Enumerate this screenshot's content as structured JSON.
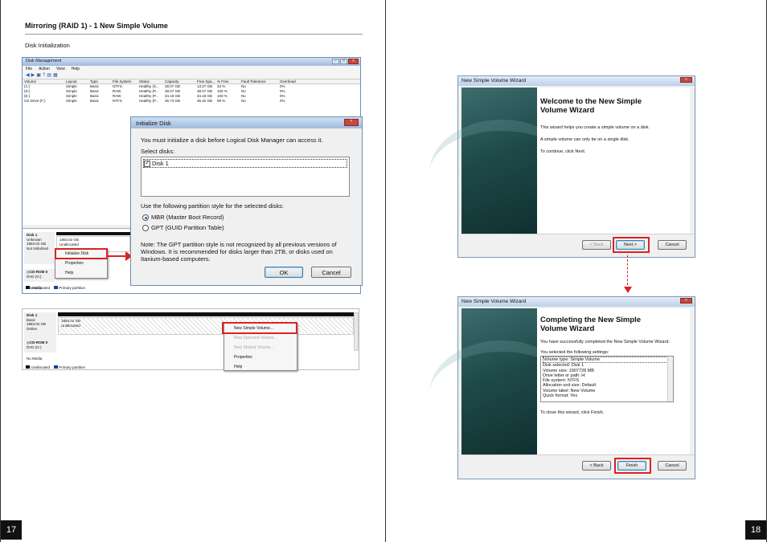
{
  "left_page": {
    "heading": "Mirroring (RAID 1) - 1 New Simple Volume",
    "subheading": "Disk Initialization",
    "page_number": "17"
  },
  "right_page": {
    "page_number": "18"
  },
  "disk_mgmt": {
    "title": "Disk Management",
    "menu": [
      "File",
      "Action",
      "View",
      "Help"
    ],
    "columns": [
      "Volume",
      "Layout",
      "Type",
      "File System",
      "Status",
      "Capacity",
      "Free Spa...",
      "% Free",
      "Fault Tolerance",
      "Overhead"
    ],
    "rows": [
      [
        "(C:)",
        "Simple",
        "Basic",
        "NTFS",
        "Healthy (S...",
        "38.07 GB",
        "13.27 GB",
        "33 %",
        "No",
        "0%"
      ],
      [
        "(D:)",
        "Simple",
        "Basic",
        "RAW",
        "Healthy (P...",
        "38.07 GB",
        "38.07 GB",
        "100 %",
        "No",
        "0%"
      ],
      [
        "(E:)",
        "Simple",
        "Basic",
        "RAW",
        "Healthy (P...",
        "34.18 GB",
        "34.18 GB",
        "100 %",
        "No",
        "0%"
      ],
      [
        "CD Drive (F:)",
        "Simple",
        "Basic",
        "NTFS",
        "Healthy (P...",
        "36.73 GB",
        "36.32 GB",
        "99 %",
        "No",
        "0%"
      ]
    ],
    "disk1": {
      "name": "Disk 1",
      "kind": "Unknown",
      "size": "1863.02 GB",
      "state": "Not Initialized"
    },
    "disk1_part": {
      "size": "1863.02 GB",
      "label": "Unallocated"
    },
    "cdrom": {
      "name": "CD-ROM 0",
      "drive": "DVD (G:)",
      "media": "No Media"
    },
    "legend": [
      "Unallocated",
      "Primary partition"
    ],
    "context_menu": [
      "Initialize Disk",
      "Properties",
      "Help"
    ]
  },
  "disk_mgmt2": {
    "disk1": {
      "name": "Disk 1",
      "kind": "Basic",
      "size": "1863.02 GB",
      "state": "Online"
    },
    "disk1_part": {
      "size": "1863.02 GB",
      "label": "Unallocated"
    },
    "cdrom": {
      "name": "CD-ROM 0",
      "drive": "DVD (G:)",
      "media": "No Media"
    },
    "legend": [
      "Unallocated",
      "Primary partition"
    ],
    "context_menu": [
      "New Simple Volume...",
      "New Spanned Volume...",
      "New Striped Volume...",
      "Properties",
      "Help"
    ]
  },
  "init_dialog": {
    "title": "Initialize Disk",
    "intro": "You must initialize a disk before Logical Disk Manager can access it.",
    "select_label": "Select disks:",
    "disk_item": "Disk 1",
    "style_label": "Use the following partition style for the selected disks:",
    "mbr": "MBR (Master Boot Record)",
    "gpt": "GPT (GUID Partition Table)",
    "note": "Note: The GPT partition style is not recognized by all previous versions of Windows. It is recommended for disks larger than 2TB, or disks used on Itanium-based computers.",
    "ok": "OK",
    "cancel": "Cancel"
  },
  "wizard1": {
    "window_title": "New Simple Volume Wizard",
    "heading": "Welcome to the New Simple Volume Wizard",
    "p1": "This wizard helps you create a simple volume on a disk.",
    "p2": "A simple volume can only be on a single disk.",
    "p3": "To continue, click Next.",
    "back": "< Back",
    "next": "Next >",
    "cancel": "Cancel"
  },
  "wizard2": {
    "window_title": "New Simple Volume Wizard",
    "heading": "Completing the New Simple Volume Wizard",
    "p1": "You have successfully completed the New Simple Volume Wizard.",
    "p2": "You selected the following settings:",
    "settings": [
      "Volume type: Simple Volume",
      "Disk selected: Disk 1",
      "Volume size: 1907728 MB",
      "Drive letter or path: H:",
      "File system: NTFS",
      "Allocation unit size: Default",
      "Volume label: New Volume",
      "Quick format: Yes"
    ],
    "p3": "To close this wizard, click Finish.",
    "back": "< Back",
    "finish": "Finish",
    "cancel": "Cancel"
  }
}
